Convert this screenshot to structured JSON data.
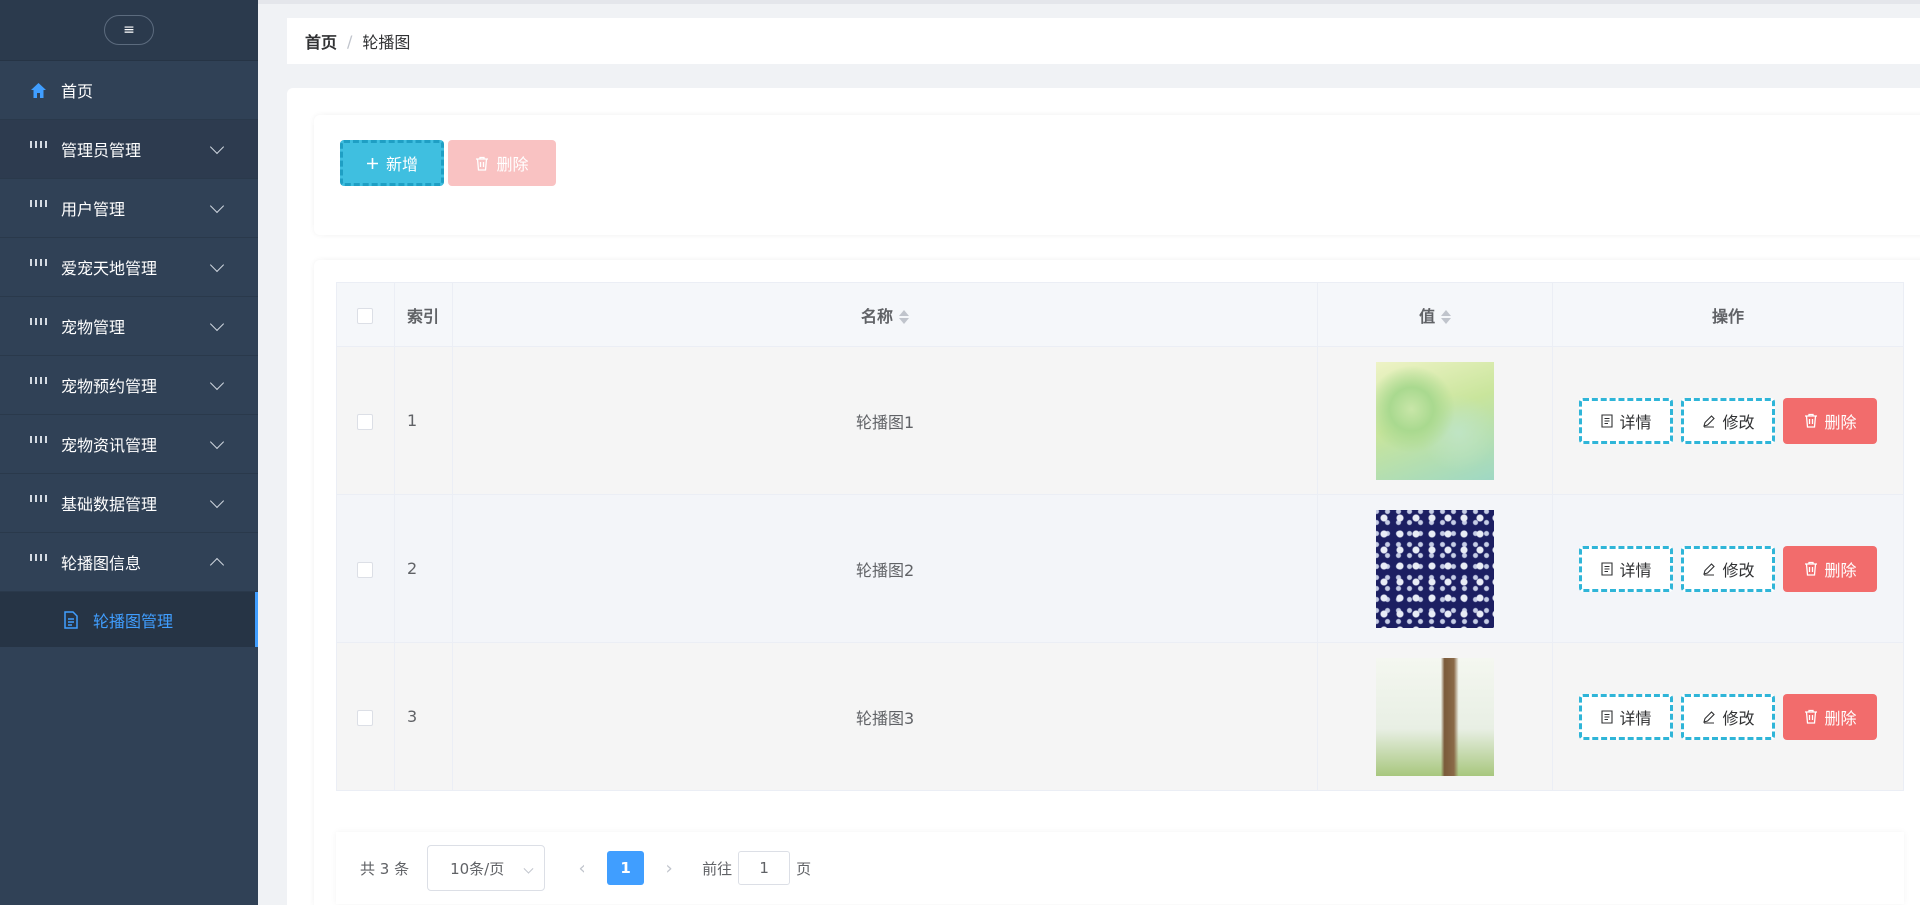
{
  "sidebar": {
    "toggle_icon": "hamburger-icon",
    "toggle_glyph": "≡",
    "items": [
      {
        "label": "首页",
        "icon": "home-icon"
      },
      {
        "label": "管理员管理",
        "icon": "grid-icon"
      },
      {
        "label": "用户管理",
        "icon": "grid-icon"
      },
      {
        "label": "爱宠天地管理",
        "icon": "grid-icon"
      },
      {
        "label": "宠物管理",
        "icon": "grid-icon"
      },
      {
        "label": "宠物预约管理",
        "icon": "grid-icon"
      },
      {
        "label": "宠物资讯管理",
        "icon": "grid-icon"
      },
      {
        "label": "基础数据管理",
        "icon": "grid-icon"
      },
      {
        "label": "轮播图信息",
        "icon": "grid-icon"
      }
    ],
    "subitem": {
      "label": "轮播图管理",
      "icon": "document-icon"
    }
  },
  "breadcrumb": {
    "home": "首页",
    "separator": "/",
    "current": "轮播图"
  },
  "toolbar": {
    "add_label": "新增",
    "delete_label": "删除"
  },
  "table": {
    "headers": {
      "index": "索引",
      "name": "名称",
      "value": "值",
      "actions": "操作"
    },
    "rows": [
      {
        "index": "1",
        "name": "轮播图1"
      },
      {
        "index": "2",
        "name": "轮播图2"
      },
      {
        "index": "3",
        "name": "轮播图3"
      }
    ],
    "actions": {
      "detail": "详情",
      "edit": "修改",
      "delete": "删除"
    }
  },
  "pagination": {
    "total": "共 3 条",
    "page_size": "10条/页",
    "current_page": "1",
    "goto_label": "前往",
    "goto_value": "1",
    "page_suffix": "页",
    "prev": "‹",
    "next": "›"
  },
  "colors": {
    "sidebar_bg": "#304156",
    "active": "#409eff",
    "add_button": "#3fbfe0",
    "delete_button": "#f26c6c",
    "delete_button_disabled": "#f9c2c2"
  }
}
